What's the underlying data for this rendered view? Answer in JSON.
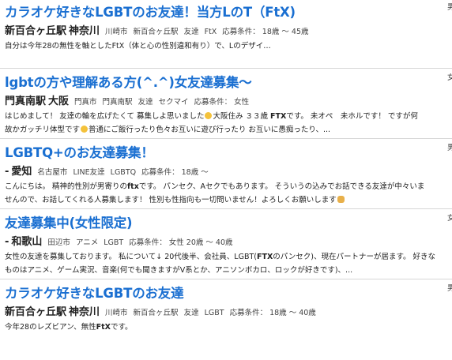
{
  "posts": [
    {
      "title": "カラオケ好きなLGBTのお友達！当方LのT（FtX)",
      "station": "新百合ヶ丘駅",
      "pref": "神奈川",
      "tags": [
        "川崎市",
        "新百合ヶ丘駅",
        "友達",
        "FtX",
        "応募条件： 18歳 〜 45歳"
      ],
      "body_lines": [
        [
          {
            "t": "自分は今年28の無性を軸としたFtX（体と心の性別違和有り）で、Lのデザイ…",
            "b": false
          }
        ]
      ]
    },
    {
      "title": "lgbtの方や理解ある方(^.^)女友達募集〜",
      "station": "門真南駅",
      "pref": "大阪",
      "tags": [
        "門真市",
        "門真南駅",
        "友達",
        "セクマイ",
        "応募条件： 女性"
      ],
      "body_lines": [
        [
          {
            "t": "はじめまして！ 友達の輪を広げたくて 募集しよ思いました",
            "b": false
          },
          {
            "emoji": "smile"
          },
          {
            "t": "大阪住み ３３歳 ",
            "b": false
          },
          {
            "t": "FTX",
            "b": true
          },
          {
            "t": "です。 未オペ　未ホルです！ ですが何",
            "b": false
          }
        ],
        [
          {
            "t": "故かガッチリ体型です",
            "b": false
          },
          {
            "emoji": "smile"
          },
          {
            "t": "普通にご飯行ったり色々お互いに遊び行ったり お互いに愚痴ったり、...",
            "b": false
          }
        ]
      ]
    },
    {
      "title": "LGBTQ+のお友達募集！",
      "station": "-",
      "pref": "愛知",
      "tags": [
        "名古屋市",
        "LINE友達",
        "LGBTQ",
        "応募条件： 18歳 〜"
      ],
      "body_lines": [
        [
          {
            "t": "こんにちは。 精神的性別が男寄りの",
            "b": false
          },
          {
            "t": "ftx",
            "b": true
          },
          {
            "t": "です。 パンセク、Aセクでもあります。 そういうの込みでお話できる友達が中々いま",
            "b": false
          }
        ],
        [
          {
            "t": "せんので、お話してくれる人募集します！ 性別も性指向も一切問いません！よろしくお願いします",
            "b": false
          },
          {
            "emoji": "pray"
          }
        ]
      ]
    },
    {
      "title": "友達募集中(女性限定)",
      "station": "-",
      "pref": "和歌山",
      "tags": [
        "田辺市",
        "アニメ",
        "LGBT",
        "応募条件： 女性 20歳 〜 40歳"
      ],
      "body_lines": [
        [
          {
            "t": "女性の友達を募集しております。 私について↓ 20代後半、会社員、LGBT(",
            "b": false
          },
          {
            "t": "FTX",
            "b": true
          },
          {
            "t": "のパンセク)、現在パートナーが居ます。 好きな",
            "b": false
          }
        ],
        [
          {
            "t": "ものはアニメ、ゲーム実況、音楽(何でも聞きますがV系とか、アニソンボカロ、ロックが好きです)、...",
            "b": false
          }
        ]
      ]
    },
    {
      "title": "カラオケ好きなLGBTのお友達",
      "station": "新百合ヶ丘駅",
      "pref": "神奈川",
      "tags": [
        "川崎市",
        "新百合ヶ丘駅",
        "友達",
        "LGBT",
        "応募条件： 18歳 〜 40歳"
      ],
      "body_lines": [
        [
          {
            "t": "今年28のレズビアン、無性",
            "b": false
          },
          {
            "t": "FtX",
            "b": true
          },
          {
            "t": "です。",
            "b": false
          }
        ]
      ]
    }
  ],
  "edge_glyphs": [
    "男",
    "女",
    "男",
    "女",
    "男"
  ]
}
